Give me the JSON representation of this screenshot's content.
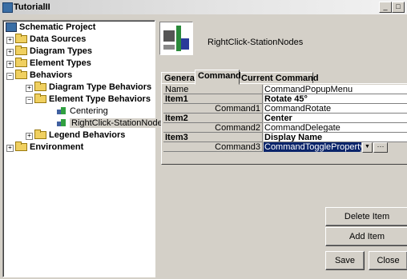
{
  "window": {
    "title": "TutorialII"
  },
  "tree": {
    "root": "Schematic Project",
    "data_sources": "Data Sources",
    "diagram_types": "Diagram Types",
    "element_types": "Element Types",
    "behaviors": "Behaviors",
    "diagram_type_behaviors": "Diagram Type Behaviors",
    "element_type_behaviors": "Element Type Behaviors",
    "centering": "Centering",
    "rightclick_station_nodes": "RightClick-StationNodes",
    "legend_behaviors": "Legend Behaviors",
    "environment": "Environment"
  },
  "header": {
    "name": "RightClick-StationNodes"
  },
  "tabs": {
    "general": "General",
    "command": "Command",
    "current_command": "Current Command"
  },
  "grid": {
    "name_key": "Name",
    "name_value": "CommandPopupMenu",
    "item1_key": "Item1",
    "item1_value": "Rotate 45°",
    "command1_key": "Command1",
    "command1_value": "CommandRotate",
    "item2_key": "Item2",
    "item2_value": "Center",
    "command2_key": "Command2",
    "command2_value": "CommandDelegate",
    "item3_key": "Item3",
    "item3_value": "Display Name",
    "command3_key": "Command3",
    "command3_value": "CommandTogglePropertyState",
    "ellipsis": "···"
  },
  "buttons": {
    "delete_item": "Delete Item",
    "add_item": "Add Item",
    "save": "Save",
    "close": "Close"
  },
  "window_controls": {
    "minimize": "_",
    "maximize": "□"
  },
  "colors": {
    "selection": "#0a246a",
    "panel": "#d4d0c8"
  }
}
